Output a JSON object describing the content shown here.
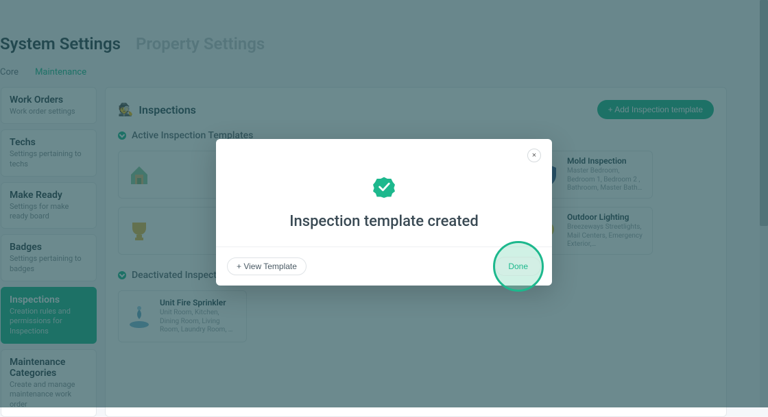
{
  "tabs": {
    "main": [
      {
        "label": "System Settings",
        "active": true
      },
      {
        "label": "Property Settings",
        "active": false
      }
    ],
    "sub": [
      {
        "label": "Core",
        "active": false
      },
      {
        "label": "Maintenance",
        "active": true
      }
    ]
  },
  "sidebar": [
    {
      "title": "Work Orders",
      "desc": "Work order settings",
      "active": false
    },
    {
      "title": "Techs",
      "desc": "Settings pertaining to techs",
      "active": false
    },
    {
      "title": "Make Ready",
      "desc": "Settings for make ready board",
      "active": false
    },
    {
      "title": "Badges",
      "desc": "Settings pertaining to badges",
      "active": false
    },
    {
      "title": "Inspections",
      "desc": "Creation rules and permissions for Inspections",
      "active": true
    },
    {
      "title": "Maintenance Categories",
      "desc": "Create and manage maintenance work order",
      "active": false
    }
  ],
  "panel": {
    "emoji": "🕵️",
    "title": "Inspections",
    "addButton": "+ Add Inspection template",
    "activeSection": "Active Inspection Templates",
    "deactivatedSection": "Deactivated Inspection Templates",
    "activeTemplates": [
      {
        "name": "",
        "desc": "",
        "icon": "house"
      },
      {
        "name": "",
        "desc": "",
        "icon": "hidden"
      },
      {
        "name": "",
        "desc": "",
        "icon": "hidden"
      },
      {
        "name": "Mold Inspection",
        "desc": "Master Bedroom, Bedroom 1, Bedroom 2 , Bathroom, Master Bath…",
        "icon": "shield"
      },
      {
        "name": "",
        "desc": "",
        "icon": "trophy"
      },
      {
        "name": "",
        "desc": "",
        "icon": "hidden"
      },
      {
        "name": "",
        "desc": "",
        "icon": "hidden"
      },
      {
        "name": "Outdoor Lighting",
        "desc": "Breezeways Streetlights, Mail Centers, Emergency Exterior,…",
        "icon": "bulb"
      }
    ],
    "deactivatedTemplates": [
      {
        "name": "Unit Fire Sprinkler",
        "desc": "Unit Room, Kitchen, Dining Room, Living Room, Laundry Room, …",
        "icon": "fountain"
      }
    ]
  },
  "modal": {
    "title": "Inspection template created",
    "viewButton": "+ View Template",
    "doneButton": "Done",
    "closeLabel": "×"
  }
}
